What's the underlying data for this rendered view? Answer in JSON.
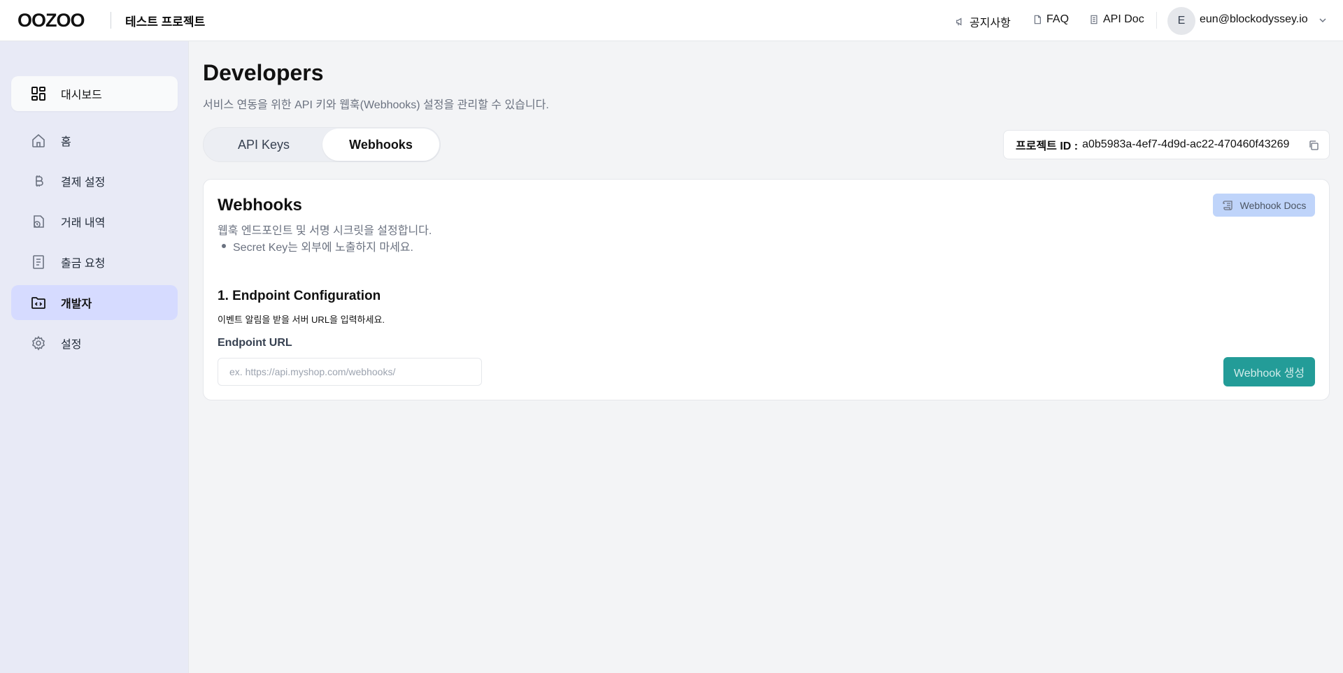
{
  "header": {
    "logo_text": "OOZOO",
    "project_name": "테스트 프로젝트",
    "links": [
      {
        "label": "공지사항",
        "icon": "megaphone-icon"
      },
      {
        "label": "FAQ",
        "icon": "document-icon"
      },
      {
        "label": "API Doc",
        "icon": "file-text-icon"
      }
    ],
    "user": {
      "avatar_letter": "E",
      "email": "eun@blockodyssey.io"
    }
  },
  "sidebar": {
    "dashboard_label": "대시보드",
    "items": [
      {
        "label": "홈",
        "icon": "home-icon",
        "active": false
      },
      {
        "label": "결제 설정",
        "icon": "bitcoin-icon",
        "active": false
      },
      {
        "label": "거래 내역",
        "icon": "transaction-history-icon",
        "active": false
      },
      {
        "label": "출금 요청",
        "icon": "receipt-icon",
        "active": false
      },
      {
        "label": "개발자",
        "icon": "code-folder-icon",
        "active": true
      },
      {
        "label": "설정",
        "icon": "gear-icon",
        "active": false
      }
    ]
  },
  "main": {
    "title": "Developers",
    "subtitle": "서비스 연동을 위한 API 키와 웹훅(Webhooks) 설정을 관리할 수 있습니다.",
    "tabs": [
      {
        "label": "API Keys",
        "active": false
      },
      {
        "label": "Webhooks",
        "active": true
      }
    ],
    "project_id": {
      "label": "프로젝트 ID :",
      "value": "a0b5983a-4ef7-4d9d-ac22-470460f43269"
    }
  },
  "card": {
    "title": "Webhooks",
    "description": "웹훅 엔드포인트 및 서명 시크릿을 설정합니다.",
    "bullet": "Secret Key는 외부에 노출하지 마세요.",
    "docs_button": "Webhook Docs",
    "section_title": "1. Endpoint Configuration",
    "section_sub": "이벤트 알림을 받을 서버 URL을 입력하세요.",
    "field_label": "Endpoint URL",
    "input_value": "",
    "input_placeholder": "ex. https://api.myshop.com/webhooks/",
    "create_button": "Webhook 생성"
  },
  "colors": {
    "active_nav": "#d6dbff",
    "sidebar_bg": "#e8eaf6",
    "primary_button": "#239c98",
    "docs_button": "#bfd4fa"
  }
}
